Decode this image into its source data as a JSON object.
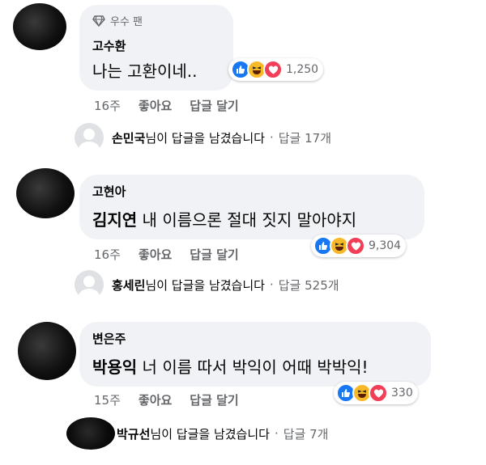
{
  "comments": [
    {
      "badge": "우수 팬",
      "author": "고수환",
      "text_plain": "나는 고환이네..",
      "reaction_count": "1,250",
      "time": "16주",
      "like_label": "좋아요",
      "reply_label": "답글 달기",
      "reply_summary": {
        "name": "손민국",
        "text": "님이 답글을 남겼습니다",
        "count": "답글 17개"
      }
    },
    {
      "author": "고현아",
      "text_bold": "김지연",
      "text_plain": " 내 이름으론 절대 짓지 말아야지",
      "reaction_count": "9,304",
      "time": "16주",
      "like_label": "좋아요",
      "reply_label": "답글 달기",
      "reply_summary": {
        "name": "홍세린",
        "text": "님이 답글을 남겼습니다",
        "count": "답글 525개"
      }
    },
    {
      "author": "변은주",
      "text_bold": "박용익",
      "text_plain": " 너 이름 따서 박익이 어때 박박익!",
      "reaction_count": "330",
      "time": "15주",
      "like_label": "좋아요",
      "reply_label": "답글 달기",
      "reply_summary": {
        "name": "박규선",
        "text": "님이 답글을 남겼습니다",
        "count": "답글 7개"
      }
    }
  ],
  "icons": {
    "badge": "diamond-icon",
    "reactions": [
      "like-reaction-icon",
      "haha-reaction-icon",
      "love-reaction-icon"
    ]
  },
  "colors": {
    "bubble": "#f0f2f5",
    "like": "#1877f2",
    "haha": "#f7b928",
    "love": "#f33e58",
    "meta": "#65676b"
  }
}
